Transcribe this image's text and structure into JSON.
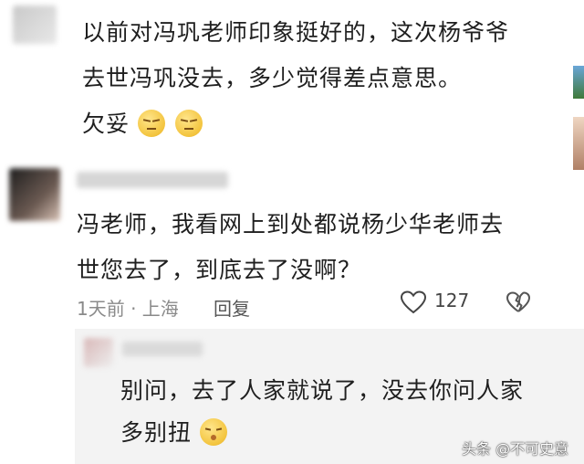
{
  "comment1": {
    "text_line1": "以前对冯巩老师印象挺好的，这次杨爷爷",
    "text_line2": "去世冯巩没去，多少觉得差点意思。",
    "text_line3": "欠妥"
  },
  "comment2": {
    "text_line1": "冯老师，我看网上到处都说杨少华老师去",
    "text_line2": "世您去了，到底去了没啊？",
    "time_location": "1天前 · 上海",
    "reply_label": "回复",
    "like_count": "127"
  },
  "reply": {
    "text_line1": "别问，去了人家就说了，没去你问人家",
    "text_line2": "多别扭"
  },
  "watermark": {
    "text": "头条 @不可史意"
  }
}
